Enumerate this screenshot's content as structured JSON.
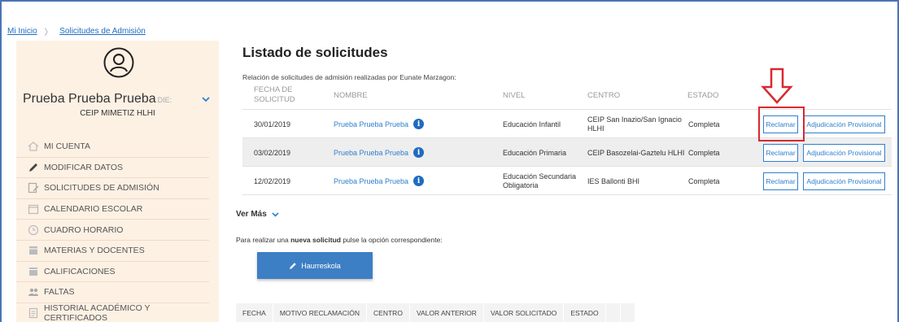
{
  "breadcrumb": {
    "home": "Mi Inicio",
    "current": "Solicitudes de Admisión"
  },
  "profile": {
    "name": "Prueba Prueba Prueba",
    "die_label": "DIE:",
    "school": "CEIP MIMETIZ HLHI"
  },
  "menu": [
    {
      "label": "MI CUENTA",
      "icon": "home-icon"
    },
    {
      "label": "MODIFICAR DATOS",
      "icon": "pencil-icon"
    },
    {
      "label": "SOLICITUDES DE ADMISIÓN",
      "icon": "document-edit-icon"
    },
    {
      "label": "CALENDARIO ESCOLAR",
      "icon": "calendar-icon"
    },
    {
      "label": "CUADRO HORARIO",
      "icon": "clock-icon"
    },
    {
      "label": "MATERIAS Y DOCENTES",
      "icon": "book-icon"
    },
    {
      "label": "CALIFICACIONES",
      "icon": "grades-icon"
    },
    {
      "label": "FALTAS",
      "icon": "people-icon"
    },
    {
      "label": "HISTORIAL ACADÉMICO Y CERTIFICADOS",
      "icon": "certificate-icon"
    }
  ],
  "main": {
    "title": "Listado de solicitudes",
    "subtitle": "Relación de solicitudes de admisión realizadas por Eunate Marzagon:",
    "columns": {
      "fecha_line1": "FECHA DE",
      "fecha_line2": "SOLICITUD",
      "nombre": "NOMBRE",
      "nivel": "NIVEL",
      "centro": "CENTRO",
      "estado": "ESTADO"
    },
    "rows": [
      {
        "fecha": "30/01/2019",
        "nombre": "Prueba Prueba Prueba",
        "nivel": "Educación Infantil",
        "centro": "CEIP San Inazio/San Ignacio HLHI",
        "estado": "Completa",
        "reclamar": "Reclamar",
        "adjudicacion": "Adjudicación Provisional"
      },
      {
        "fecha": "03/02/2019",
        "nombre": "Prueba Prueba Prueba",
        "nivel": "Educación Primaria",
        "centro": "CEIP Basozelai-Gaztelu HLHI",
        "estado": "Completa",
        "reclamar": "Reclamar",
        "adjudicacion": "Adjudicación Provisional"
      },
      {
        "fecha": "12/02/2019",
        "nombre": "Prueba Prueba Prueba",
        "nivel": "Educación Secundaria Obligatoria",
        "centro": "IES Ballonti BHI",
        "estado": "Completa",
        "reclamar": "Reclamar",
        "adjudicacion": "Adjudicación Provisional"
      }
    ],
    "info_glyph": "i",
    "ver_mas": "Ver Más",
    "nueva_prefix": "Para realizar una ",
    "nueva_bold": "nueva solicitud",
    "nueva_suffix": " pulse la opción correspondiente:",
    "haurreskola_button": "Haurreskola",
    "reclamaciones_columns": [
      "FECHA",
      "MOTIVO RECLAMACIÓN",
      "CENTRO",
      "VALOR ANTERIOR",
      "VALOR SOLICITADO",
      "ESTADO"
    ]
  },
  "colors": {
    "accent": "#2f7fcf",
    "sidebar_bg": "#fdf1e4",
    "highlight": "#d8292f",
    "button_bg": "#3d7fc4"
  }
}
